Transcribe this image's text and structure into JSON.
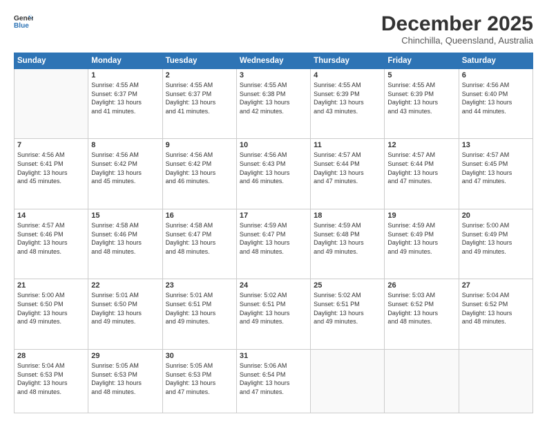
{
  "logo": {
    "general": "General",
    "blue": "Blue"
  },
  "title": "December 2025",
  "location": "Chinchilla, Queensland, Australia",
  "days_of_week": [
    "Sunday",
    "Monday",
    "Tuesday",
    "Wednesday",
    "Thursday",
    "Friday",
    "Saturday"
  ],
  "weeks": [
    [
      {
        "day": "",
        "text": ""
      },
      {
        "day": "1",
        "text": "Sunrise: 4:55 AM\nSunset: 6:37 PM\nDaylight: 13 hours\nand 41 minutes."
      },
      {
        "day": "2",
        "text": "Sunrise: 4:55 AM\nSunset: 6:37 PM\nDaylight: 13 hours\nand 41 minutes."
      },
      {
        "day": "3",
        "text": "Sunrise: 4:55 AM\nSunset: 6:38 PM\nDaylight: 13 hours\nand 42 minutes."
      },
      {
        "day": "4",
        "text": "Sunrise: 4:55 AM\nSunset: 6:39 PM\nDaylight: 13 hours\nand 43 minutes."
      },
      {
        "day": "5",
        "text": "Sunrise: 4:55 AM\nSunset: 6:39 PM\nDaylight: 13 hours\nand 43 minutes."
      },
      {
        "day": "6",
        "text": "Sunrise: 4:56 AM\nSunset: 6:40 PM\nDaylight: 13 hours\nand 44 minutes."
      }
    ],
    [
      {
        "day": "7",
        "text": "Sunrise: 4:56 AM\nSunset: 6:41 PM\nDaylight: 13 hours\nand 45 minutes."
      },
      {
        "day": "8",
        "text": "Sunrise: 4:56 AM\nSunset: 6:42 PM\nDaylight: 13 hours\nand 45 minutes."
      },
      {
        "day": "9",
        "text": "Sunrise: 4:56 AM\nSunset: 6:42 PM\nDaylight: 13 hours\nand 46 minutes."
      },
      {
        "day": "10",
        "text": "Sunrise: 4:56 AM\nSunset: 6:43 PM\nDaylight: 13 hours\nand 46 minutes."
      },
      {
        "day": "11",
        "text": "Sunrise: 4:57 AM\nSunset: 6:44 PM\nDaylight: 13 hours\nand 47 minutes."
      },
      {
        "day": "12",
        "text": "Sunrise: 4:57 AM\nSunset: 6:44 PM\nDaylight: 13 hours\nand 47 minutes."
      },
      {
        "day": "13",
        "text": "Sunrise: 4:57 AM\nSunset: 6:45 PM\nDaylight: 13 hours\nand 47 minutes."
      }
    ],
    [
      {
        "day": "14",
        "text": "Sunrise: 4:57 AM\nSunset: 6:46 PM\nDaylight: 13 hours\nand 48 minutes."
      },
      {
        "day": "15",
        "text": "Sunrise: 4:58 AM\nSunset: 6:46 PM\nDaylight: 13 hours\nand 48 minutes."
      },
      {
        "day": "16",
        "text": "Sunrise: 4:58 AM\nSunset: 6:47 PM\nDaylight: 13 hours\nand 48 minutes."
      },
      {
        "day": "17",
        "text": "Sunrise: 4:59 AM\nSunset: 6:47 PM\nDaylight: 13 hours\nand 48 minutes."
      },
      {
        "day": "18",
        "text": "Sunrise: 4:59 AM\nSunset: 6:48 PM\nDaylight: 13 hours\nand 49 minutes."
      },
      {
        "day": "19",
        "text": "Sunrise: 4:59 AM\nSunset: 6:49 PM\nDaylight: 13 hours\nand 49 minutes."
      },
      {
        "day": "20",
        "text": "Sunrise: 5:00 AM\nSunset: 6:49 PM\nDaylight: 13 hours\nand 49 minutes."
      }
    ],
    [
      {
        "day": "21",
        "text": "Sunrise: 5:00 AM\nSunset: 6:50 PM\nDaylight: 13 hours\nand 49 minutes."
      },
      {
        "day": "22",
        "text": "Sunrise: 5:01 AM\nSunset: 6:50 PM\nDaylight: 13 hours\nand 49 minutes."
      },
      {
        "day": "23",
        "text": "Sunrise: 5:01 AM\nSunset: 6:51 PM\nDaylight: 13 hours\nand 49 minutes."
      },
      {
        "day": "24",
        "text": "Sunrise: 5:02 AM\nSunset: 6:51 PM\nDaylight: 13 hours\nand 49 minutes."
      },
      {
        "day": "25",
        "text": "Sunrise: 5:02 AM\nSunset: 6:51 PM\nDaylight: 13 hours\nand 49 minutes."
      },
      {
        "day": "26",
        "text": "Sunrise: 5:03 AM\nSunset: 6:52 PM\nDaylight: 13 hours\nand 48 minutes."
      },
      {
        "day": "27",
        "text": "Sunrise: 5:04 AM\nSunset: 6:52 PM\nDaylight: 13 hours\nand 48 minutes."
      }
    ],
    [
      {
        "day": "28",
        "text": "Sunrise: 5:04 AM\nSunset: 6:53 PM\nDaylight: 13 hours\nand 48 minutes."
      },
      {
        "day": "29",
        "text": "Sunrise: 5:05 AM\nSunset: 6:53 PM\nDaylight: 13 hours\nand 48 minutes."
      },
      {
        "day": "30",
        "text": "Sunrise: 5:05 AM\nSunset: 6:53 PM\nDaylight: 13 hours\nand 47 minutes."
      },
      {
        "day": "31",
        "text": "Sunrise: 5:06 AM\nSunset: 6:54 PM\nDaylight: 13 hours\nand 47 minutes."
      },
      {
        "day": "",
        "text": ""
      },
      {
        "day": "",
        "text": ""
      },
      {
        "day": "",
        "text": ""
      }
    ]
  ]
}
